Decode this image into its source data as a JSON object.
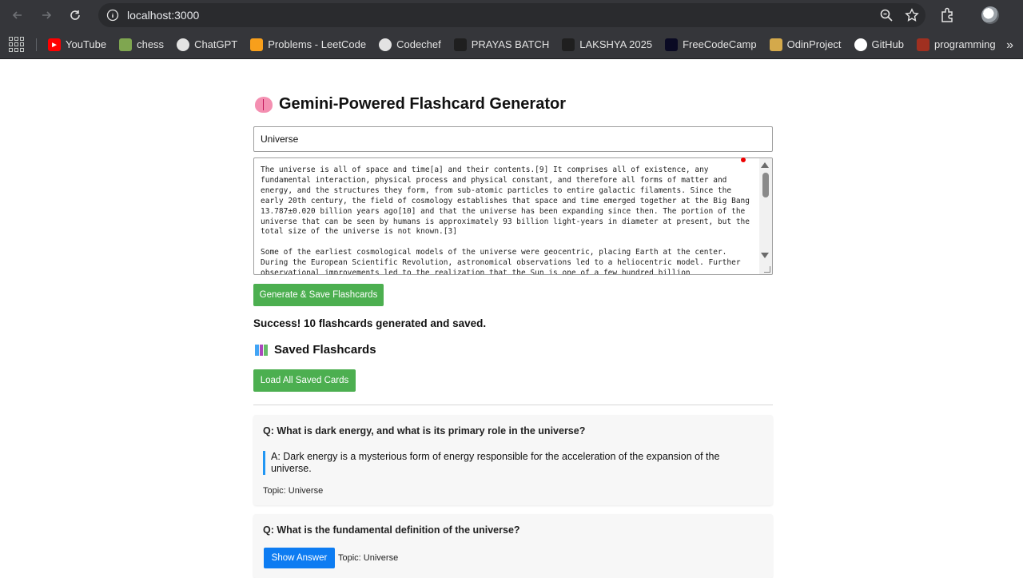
{
  "browser": {
    "url": "localhost:3000",
    "bookmarks": [
      {
        "label": "YouTube",
        "icon": "youtube-icon",
        "color": "#ff0000"
      },
      {
        "label": "chess",
        "icon": "chess-pawn-icon",
        "color": "#7fa650"
      },
      {
        "label": "ChatGPT",
        "icon": "chatgpt-icon",
        "color": "#e3e3e3"
      },
      {
        "label": "Problems - LeetCode",
        "icon": "leetcode-icon",
        "color": "#f89f1b"
      },
      {
        "label": "Codechef",
        "icon": "codechef-icon",
        "color": "#e3e3e3"
      },
      {
        "label": "PRAYAS BATCH",
        "icon": "pw-icon",
        "color": "#1f1f1f"
      },
      {
        "label": "LAKSHYA 2025",
        "icon": "pw-icon",
        "color": "#1f1f1f"
      },
      {
        "label": "FreeCodeCamp",
        "icon": "freecodecamp-icon",
        "color": "#0a0a23"
      },
      {
        "label": "OdinProject",
        "icon": "odin-icon",
        "color": "#d4a94b"
      },
      {
        "label": "GitHub",
        "icon": "github-icon",
        "color": "#ffffff"
      },
      {
        "label": "programming",
        "icon": "folder-icon",
        "color": "#a03020"
      }
    ]
  },
  "app": {
    "title": "Gemini-Powered Flashcard Generator",
    "topic_value": "Universe",
    "text_value": "The universe is all of space and time[a] and their contents.[9] It comprises all of existence, any fundamental interaction, physical process and physical constant, and therefore all forms of matter and energy, and the structures they form, from sub-atomic particles to entire galactic filaments. Since the early 20th century, the field of cosmology establishes that space and time emerged together at the Big Bang 13.787±0.020 billion years ago[10] and that the universe has been expanding since then. The portion of the universe that can be seen by humans is approximately 93 billion light-years in diameter at present, but the total size of the universe is not known.[3]\n\nSome of the earliest cosmological models of the universe were geocentric, placing Earth at the center. During the European Scientific Revolution, astronomical observations led to a heliocentric model. Further observational improvements led to the realization that the Sun is one of a few hundred billion",
    "generate_label": "Generate & Save Flashcards",
    "status": "Success! 10 flashcards generated and saved.",
    "saved_heading": "Saved Flashcards",
    "load_label": "Load All Saved Cards",
    "accent": "#4caf50",
    "cards": [
      {
        "question": "Q: What is dark energy, and what is its primary role in the universe?",
        "answer": "A: Dark energy is a mysterious form of energy responsible for the acceleration of the expansion of the universe.",
        "topic": "Topic: Universe"
      },
      {
        "question": "Q: What is the fundamental definition of the universe?",
        "show_label": "Show Answer",
        "topic": "Topic: Universe"
      }
    ]
  }
}
